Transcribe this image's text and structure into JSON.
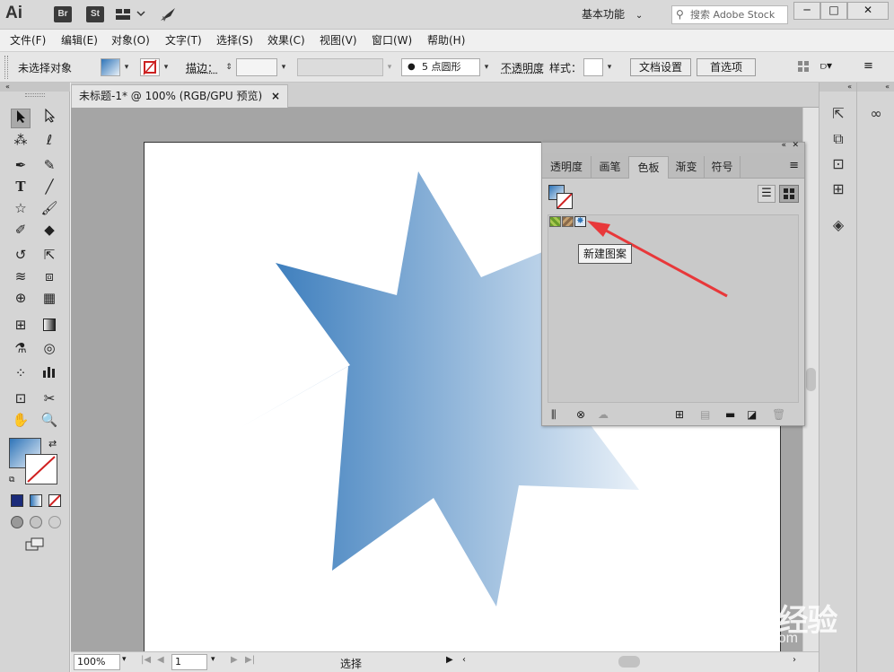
{
  "app": {
    "logo": "Ai",
    "bridge_label": "Br",
    "stock_label": "St",
    "workspace": "基本功能",
    "search_placeholder": "搜索 Adobe Stock"
  },
  "menu": [
    "文件(F)",
    "编辑(E)",
    "对象(O)",
    "文字(T)",
    "选择(S)",
    "效果(C)",
    "视图(V)",
    "窗口(W)",
    "帮助(H)"
  ],
  "control_bar": {
    "selection_status": "未选择对象",
    "stroke_label": "描边：",
    "brush_label": "5 点圆形",
    "opacity_label": "不透明度",
    "style_label": "样式：",
    "doc_setup_button": "文档设置",
    "preferences_button": "首选项"
  },
  "document": {
    "tab_title": "未标题-1* @ 100% (RGB/GPU 预览)",
    "close_glyph": "×"
  },
  "swatches_panel": {
    "tabs": [
      "透明度",
      "画笔",
      "色板",
      "渐变",
      "符号"
    ],
    "active_tab": "色板",
    "tooltip": "新建图案"
  },
  "status_bar": {
    "zoom": "100%",
    "artboard_number": "1",
    "tool_status": "选择"
  },
  "watermark": {
    "logo": "Bai du 经验",
    "url": "jingyan.baidu.com"
  },
  "colors": {
    "gradient_start": "#2e74b8",
    "gradient_end": "#e8f0f8",
    "arrow": "#e8383a"
  }
}
